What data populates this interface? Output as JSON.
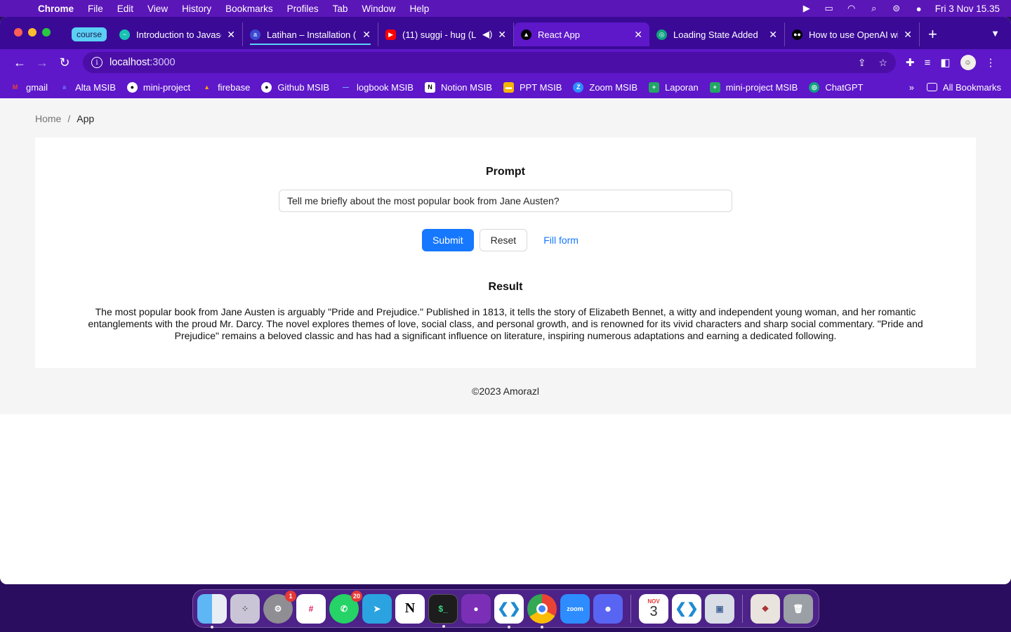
{
  "menubar": {
    "app": "Chrome",
    "items": [
      "File",
      "Edit",
      "View",
      "History",
      "Bookmarks",
      "Profiles",
      "Tab",
      "Window",
      "Help"
    ],
    "clock": "Fri 3 Nov  15.35"
  },
  "tabs": {
    "group_label": "course",
    "items": [
      {
        "title": "Introduction to Javasc",
        "icon": "course-favicon",
        "color": "#17c3b2"
      },
      {
        "title": "Latihan – Installation (",
        "icon": "site-favicon",
        "color": "#3a4bd1"
      },
      {
        "title": "(11) suggi - hug (L",
        "icon": "youtube-favicon",
        "color": "#ff0000"
      },
      {
        "title": "React App",
        "icon": "react-favicon",
        "color": "#000000"
      },
      {
        "title": "Loading State Added",
        "icon": "openai-favicon",
        "color": "#10a37f"
      },
      {
        "title": "How to use OpenAI wi",
        "icon": "medium-favicon",
        "color": "#000000"
      }
    ]
  },
  "address_bar": {
    "host": "localhost",
    "port": ":3000"
  },
  "bookmarks": {
    "items": [
      {
        "label": "gmail",
        "color": "#ea4335",
        "glyph": "M"
      },
      {
        "label": "Alta MSIB",
        "color": "#2b3aa8",
        "glyph": "a"
      },
      {
        "label": "mini-project",
        "color": "#ffffff",
        "glyph": "●"
      },
      {
        "label": "firebase",
        "color": "#ffa000",
        "glyph": "▲"
      },
      {
        "label": "Github MSIB",
        "color": "#ffffff",
        "glyph": "●"
      },
      {
        "label": "logbook MSIB",
        "color": "#2c6bd6",
        "glyph": "—"
      },
      {
        "label": "Notion MSIB",
        "color": "#ffffff",
        "glyph": "N"
      },
      {
        "label": "PPT MSIB",
        "color": "#f6b400",
        "glyph": "▬"
      },
      {
        "label": "Zoom MSIB",
        "color": "#2d8cff",
        "glyph": "Z"
      },
      {
        "label": "Laporan",
        "color": "#23a566",
        "glyph": "+"
      },
      {
        "label": "mini-project MSIB",
        "color": "#23a566",
        "glyph": "+"
      },
      {
        "label": "ChatGPT",
        "color": "#10a37f",
        "glyph": "◎"
      }
    ],
    "all_bookmarks": "All Bookmarks"
  },
  "page": {
    "breadcrumb": {
      "home": "Home",
      "separator": "/",
      "current": "App"
    },
    "prompt_title": "Prompt",
    "prompt_value": "Tell me briefly about the most popular book from Jane Austen?",
    "buttons": {
      "submit": "Submit",
      "reset": "Reset",
      "fill": "Fill form"
    },
    "result_title": "Result",
    "result_text": "The most popular book from Jane Austen is arguably \"Pride and Prejudice.\" Published in 1813, it tells the story of Elizabeth Bennet, a witty and independent young woman, and her romantic entanglements with the proud Mr. Darcy. The novel explores themes of love, social class, and personal growth, and is renowned for its vivid characters and sharp social commentary. \"Pride and Prejudice\" remains a beloved classic and has had a significant influence on literature, inspiring numerous adaptations and earning a dedicated following.",
    "footer": "©2023 Amorazl"
  },
  "dock": {
    "apps": [
      {
        "name": "finder-icon",
        "color": "#3d9cf0",
        "running": true
      },
      {
        "name": "launchpad-icon",
        "color": "#b8b8c8",
        "running": false
      },
      {
        "name": "system-settings-icon",
        "color": "#8e8e93",
        "badge": "1",
        "running": false
      },
      {
        "name": "slack-icon",
        "color": "#ffffff",
        "running": false
      },
      {
        "name": "whatsapp-icon",
        "color": "#25d366",
        "badge": "20",
        "running": false
      },
      {
        "name": "telegram-icon",
        "color": "#2aa3e0",
        "running": false
      },
      {
        "name": "notion-icon",
        "color": "#ffffff",
        "running": false
      },
      {
        "name": "terminal-icon",
        "color": "#1d1d1d",
        "running": true
      },
      {
        "name": "github-desktop-icon",
        "color": "#7b2fb6",
        "running": false
      },
      {
        "name": "vscode-icon",
        "color": "#ffffff",
        "running": true
      },
      {
        "name": "chrome-icon",
        "color": "#ffffff",
        "running": true
      },
      {
        "name": "zoom-icon",
        "color": "#2d8cff",
        "label": "zoom",
        "running": false
      },
      {
        "name": "discord-icon",
        "color": "#5865f2",
        "running": false
      },
      {
        "name": "calendar-icon",
        "color": "#ffffff",
        "month": "NOV",
        "day": "3",
        "running": false
      },
      {
        "name": "vscode-alt-icon",
        "color": "#ffffff",
        "running": false
      },
      {
        "name": "preview-icon",
        "color": "#d8dde6",
        "running": false
      },
      {
        "name": "downloads-icon",
        "color": "#e9e4dd",
        "running": false
      },
      {
        "name": "trash-icon",
        "color": "#9aa0a6",
        "running": false
      }
    ]
  }
}
